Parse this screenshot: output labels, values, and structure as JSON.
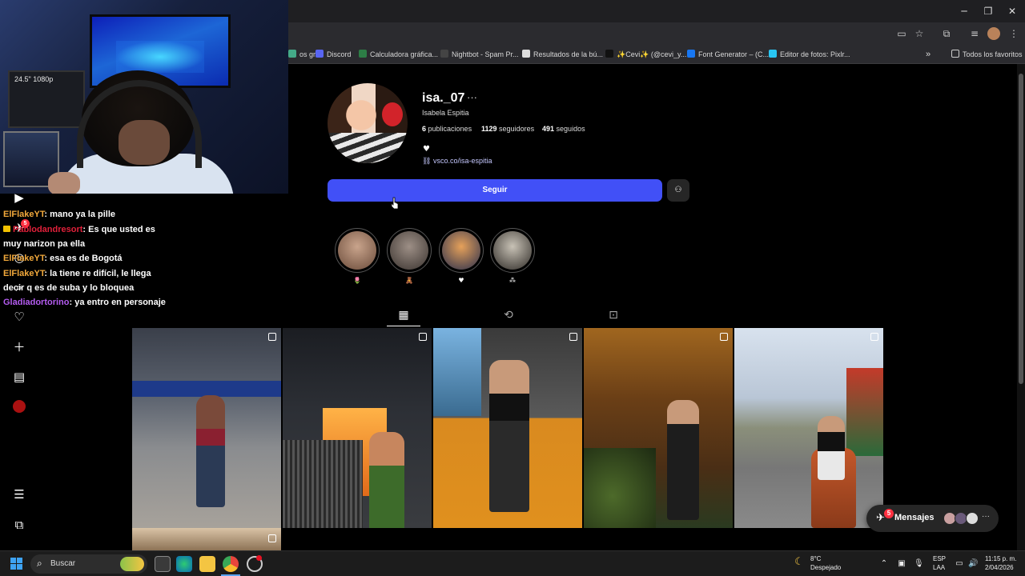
{
  "browser": {
    "bookmarks": [
      {
        "label": "os gr...",
        "color": "#4a8"
      },
      {
        "label": "Discord",
        "color": "#5865F2"
      },
      {
        "label": "Calculadora gráfica...",
        "color": "#2d7d46"
      },
      {
        "label": "Nightbot - Spam Pr...",
        "color": "#444"
      },
      {
        "label": "Resultados de la bú...",
        "color": "#ddd"
      },
      {
        "label": "✨Cevi✨ (@cevi_y...",
        "color": "#111"
      },
      {
        "label": "Font Generator – (C...",
        "color": "#1877f2"
      },
      {
        "label": "Editor de fotos: Pixlr...",
        "color": "#29c6f3"
      }
    ],
    "all_bookmarks_label": "Todos los favoritos"
  },
  "webcam": {
    "monitor_label": "24.5\" 1080p"
  },
  "chat": [
    {
      "user": "ElFlakeYT",
      "user_color": "#f2a93b",
      "text": ": mano ya la pille"
    },
    {
      "user": "Pablodandresort",
      "user_color": "#e0203a",
      "text": ": Es que usted es muy narizon pa ella"
    },
    {
      "user": "ElFlakeYT",
      "user_color": "#f2a93b",
      "text": ": esa es de Bogotá"
    },
    {
      "user": "ElFlakeYT",
      "user_color": "#f2a93b",
      "text": ": la tiene re difícil, le llega decir q es de suba y lo bloquea"
    },
    {
      "user": "Gladiadortorino",
      "user_color": "#b45cf0",
      "text": ": ya entro en personaje"
    }
  ],
  "nav": {
    "notification_badge": "5"
  },
  "profile": {
    "username": "isa._07",
    "full_name": "Isabela Espitia",
    "posts_count": "6",
    "posts_label": "publicaciones",
    "followers_count": "1129",
    "followers_label": "seguidores",
    "following_count": "491",
    "following_label": "seguidos",
    "bio_heart": "♥",
    "link": "vsco.co/isa-espitia",
    "follow_label": "Seguir"
  },
  "highlights": [
    {
      "label": "🌷",
      "color_a": "#c9a48c",
      "color_b": "#6a4b3a"
    },
    {
      "label": "🧸",
      "color_a": "#9d8f86",
      "color_b": "#3b3430"
    },
    {
      "label": "♥",
      "color_a": "#e6a15a",
      "color_b": "#2a2f4d"
    },
    {
      "label": "⁂",
      "color_a": "#c8c2b6",
      "color_b": "#2f2b27"
    }
  ],
  "messages": {
    "label": "Mensajes",
    "badge": "5"
  },
  "taskbar": {
    "search_placeholder": "Buscar",
    "weather_temp": "8°C",
    "weather_desc": "Despejado",
    "lang_top": "ESP",
    "lang_bottom": "LAA",
    "time": "11:15 p. m.",
    "date": "2/04/2026"
  },
  "colors": {
    "follow_button": "#4150f7",
    "background": "#000000"
  }
}
